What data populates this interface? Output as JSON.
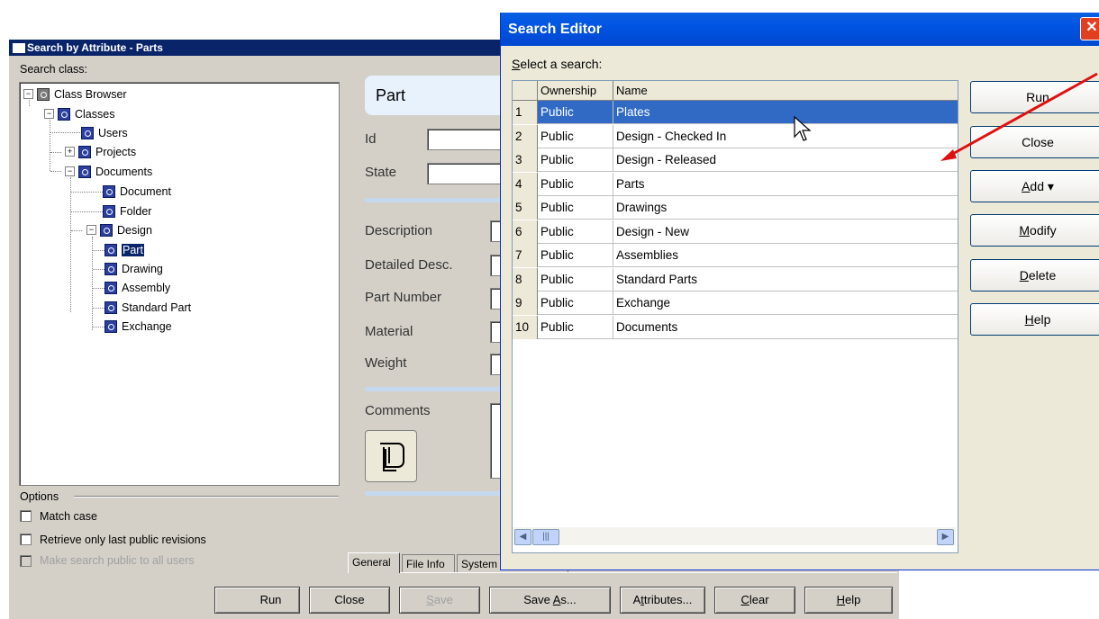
{
  "back_window": {
    "title": "Search by Attribute - Parts",
    "search_class_label": "Search class:",
    "tree": [
      {
        "label": "Class Browser"
      },
      {
        "label": "Classes"
      },
      {
        "label": "Users"
      },
      {
        "label": "Projects"
      },
      {
        "label": "Documents"
      },
      {
        "label": "Document"
      },
      {
        "label": "Folder"
      },
      {
        "label": "Design"
      },
      {
        "label": "Part"
      },
      {
        "label": "Drawing"
      },
      {
        "label": "Assembly"
      },
      {
        "label": "Standard Part"
      },
      {
        "label": "Exchange"
      }
    ],
    "options_label": "Options",
    "options": [
      {
        "label": "Match case",
        "checked": false,
        "enabled": true
      },
      {
        "label": "Retrieve only last public revisions",
        "checked": false,
        "enabled": true
      },
      {
        "label": "Make search public to all users",
        "checked": false,
        "enabled": false
      }
    ],
    "form_title": "Part",
    "fields": {
      "id": "Id",
      "state": "State",
      "description": "Description",
      "detailed_desc": "Detailed Desc.",
      "part_number": "Part Number",
      "material": "Material",
      "weight": "Weight",
      "comments": "Comments"
    },
    "tabs": [
      "General",
      "File Info",
      "System Information"
    ],
    "buttons": {
      "run": "Run",
      "close": "Close",
      "save": "Save",
      "save_as": "Save As...",
      "attributes": "Attributes...",
      "clear": "Clear",
      "help": "Help"
    }
  },
  "search_editor": {
    "title": "Search Editor",
    "select_label": "Select a search:",
    "columns": [
      "Ownership",
      "Name"
    ],
    "rows": [
      {
        "n": "1",
        "ownership": "Public",
        "name": "Plates",
        "selected": true
      },
      {
        "n": "2",
        "ownership": "Public",
        "name": "Design - Checked In"
      },
      {
        "n": "3",
        "ownership": "Public",
        "name": "Design - Released"
      },
      {
        "n": "4",
        "ownership": "Public",
        "name": "Parts"
      },
      {
        "n": "5",
        "ownership": "Public",
        "name": "Drawings"
      },
      {
        "n": "6",
        "ownership": "Public",
        "name": "Design - New"
      },
      {
        "n": "7",
        "ownership": "Public",
        "name": "Assemblies"
      },
      {
        "n": "8",
        "ownership": "Public",
        "name": "Standard Parts"
      },
      {
        "n": "9",
        "ownership": "Public",
        "name": "Exchange"
      },
      {
        "n": "10",
        "ownership": "Public",
        "name": "Documents"
      }
    ],
    "buttons": {
      "run": "Run",
      "close": "Close",
      "add": "Add",
      "modify": "Modify",
      "delete": "Delete",
      "help": "Help"
    },
    "close_glyph": "✕"
  },
  "colors": {
    "selection": "#316ac5",
    "xp_title": "#0054e3",
    "classic_title": "#0a246a",
    "annotation_arrow": "#e01010"
  }
}
